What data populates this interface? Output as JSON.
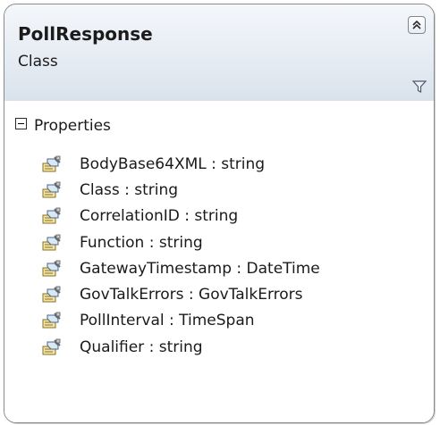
{
  "class": {
    "name": "PollResponse",
    "kind": "Class"
  },
  "section": {
    "label": "Properties"
  },
  "members": [
    "BodyBase64XML : string",
    "Class : string",
    "CorrelationID : string",
    "Function : string",
    "GatewayTimestamp : DateTime",
    "GovTalkErrors : GovTalkErrors",
    "PollInterval : TimeSpan",
    "Qualifier : string"
  ],
  "icons": {
    "collapse": "double-chevron-up-icon",
    "filter": "filter-icon",
    "member": "property-icon"
  },
  "colors": {
    "header_top": "#f4f7fb",
    "header_bottom": "#d9e2ec",
    "border": "#8a8a8a"
  }
}
